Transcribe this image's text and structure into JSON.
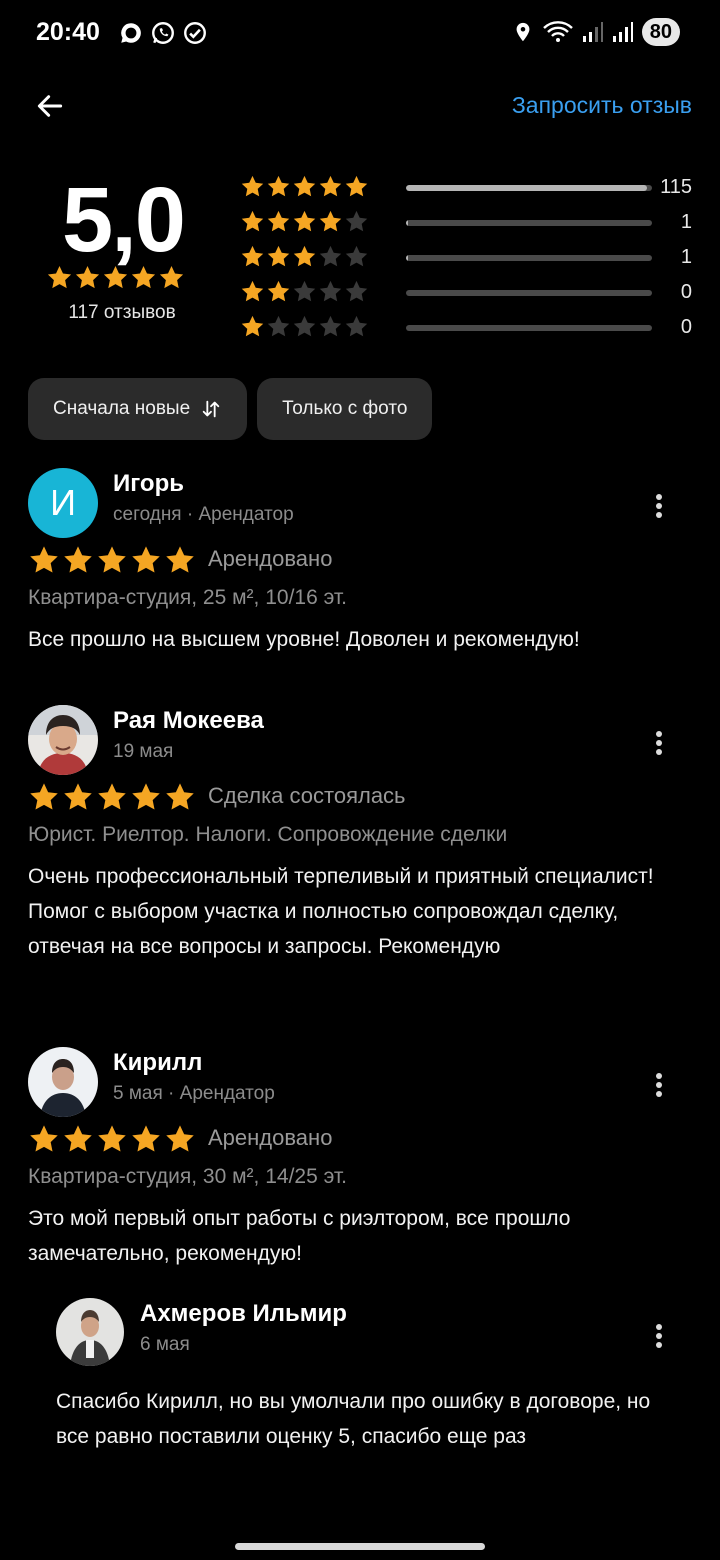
{
  "status_bar": {
    "time": "20:40",
    "battery": "80",
    "icons_left": [
      "chat-bubble-icon",
      "whatsapp-icon",
      "check-circle-icon"
    ],
    "icons_right": [
      "location-icon",
      "wifi-icon",
      "signal-icon",
      "signal-icon"
    ]
  },
  "header": {
    "back_icon": "arrow-left-icon",
    "request_review_label": "Запросить отзыв"
  },
  "summary": {
    "rating": "5,0",
    "stars": 5,
    "review_count": "117 отзывов",
    "distribution": [
      {
        "stars": 5,
        "count": "115",
        "fraction": 0.98
      },
      {
        "stars": 4,
        "count": "1",
        "fraction": 0.01
      },
      {
        "stars": 3,
        "count": "1",
        "fraction": 0.01
      },
      {
        "stars": 2,
        "count": "0",
        "fraction": 0
      },
      {
        "stars": 1,
        "count": "0",
        "fraction": 0
      }
    ]
  },
  "colors": {
    "star_active": "#f5a623",
    "star_inactive": "#3a3a3a",
    "link": "#3a9ff0",
    "avatar_letter_bg": "#18b5d6"
  },
  "filters": {
    "sort_label": "Сначала новые",
    "sort_icon": "sort-arrows-icon",
    "photo_label": "Только с фото"
  },
  "reviews": [
    {
      "name": "Игорь",
      "avatar_letter": "И",
      "meta": "сегодня · Арендатор",
      "stars": 5,
      "deal": "Арендовано",
      "object": "Квартира-студия, 25 м², 10/16 эт.",
      "text": "Все прошло на высшем уровне! Доволен и рекомендую!"
    },
    {
      "name": "Рая Мокеева",
      "meta": "19 мая",
      "stars": 5,
      "deal": "Сделка состоялась",
      "object": "Юрист. Риелтор. Налоги. Сопровождение сделки",
      "text": "Очень профессиональный терпеливый и приятный специалист! Помог с выбором участка и полностью сопровождал сделку, отвечая на все вопросы и запросы. Рекомендую"
    },
    {
      "name": "Кирилл",
      "meta": "5 мая · Арендатор",
      "stars": 5,
      "deal": "Арендовано",
      "object": "Квартира-студия, 30 м², 14/25 эт.",
      "text": "Это мой первый опыт работы с риэлтором, все прошло замечательно, рекомендую!"
    }
  ],
  "reply": {
    "name": "Ахмеров Ильмир",
    "meta": "6 мая",
    "text": "Спасибо Кирилл, но вы умолчали про ошибку в договоре, но все равно поставили оценку 5, спасибо еще раз"
  }
}
